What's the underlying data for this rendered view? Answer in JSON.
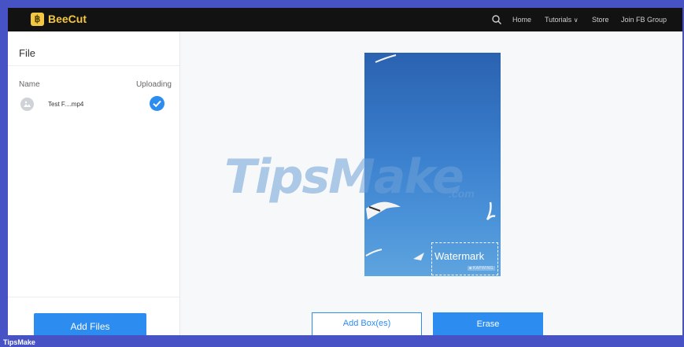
{
  "header": {
    "app_name": "BeeCut",
    "logo_glyph": "฿",
    "nav": [
      "Home",
      "Tutorials",
      "Store",
      "Join FB Group"
    ],
    "tutorials_caret": "∨"
  },
  "sidebar": {
    "title": "File",
    "columns": {
      "name": "Name",
      "status": "Uploading"
    },
    "files": [
      {
        "name": "Test F....mp4",
        "status_icon": "check-icon"
      }
    ],
    "add_button": "Add Files"
  },
  "preview": {
    "watermark_text": "Watermark",
    "watermark_sub": "■ KAPWING"
  },
  "overlay": {
    "brand": "TipsMake",
    "brand_suffix": ".com"
  },
  "actions": {
    "add_box": "Add Box(es)",
    "erase": "Erase"
  },
  "footer": {
    "label": "TipsMake"
  },
  "colors": {
    "accent": "#2d8cf0",
    "logo": "#f2c744",
    "topbar": "#121212",
    "frame": "#4752c4"
  }
}
